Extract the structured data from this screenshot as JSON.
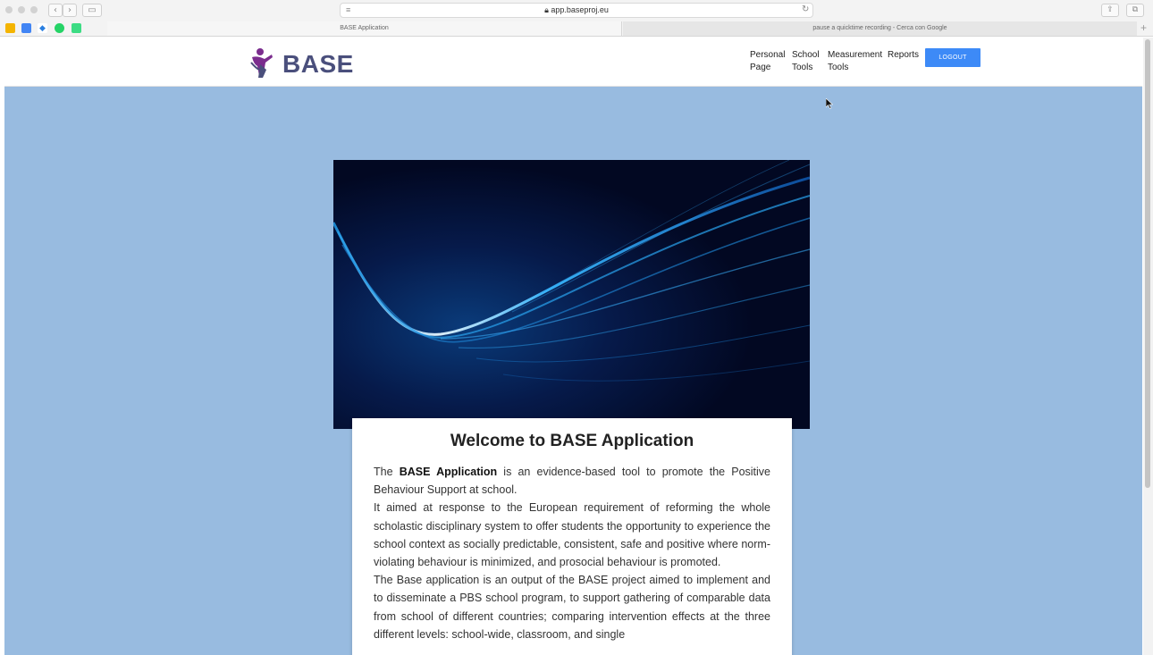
{
  "browser": {
    "url": "app.baseproj.eu",
    "tabs": [
      {
        "label": "BASE Application",
        "active": true
      },
      {
        "label": "pause a quicktime recording - Cerca con Google",
        "active": false
      }
    ],
    "favorite_icons": [
      "google-drive-icon",
      "google-translate-icon",
      "dropbox-icon",
      "whatsapp-icon",
      "android-icon"
    ]
  },
  "header": {
    "logo_text": "BASE",
    "nav": [
      {
        "line1": "Personal",
        "line2": "Page"
      },
      {
        "line1": "School",
        "line2": "Tools"
      },
      {
        "line1": "Measurement",
        "line2": "Tools"
      },
      {
        "line1": "Reports",
        "line2": ""
      }
    ],
    "logout_label": "LOGOUT"
  },
  "main": {
    "title": "Welcome to BASE Application",
    "intro_prefix": "The ",
    "intro_bold": "BASE Application",
    "intro_rest": " is an evidence-based tool to promote the Positive Behaviour Support at school.",
    "paragraph2": "It aimed at response to the European requirement of reforming the whole scholastic disciplinary system to offer students the opportunity to experience the school context as socially predictable, consistent, safe and positive where norm-violating behaviour is minimized, and prosocial behaviour is promoted.",
    "paragraph3": "The Base application is an output of the BASE project aimed to implement and to disseminate a PBS school program, to support gathering of comparable data from school of different countries; comparing intervention effects at the three different levels: school-wide, classroom, and single"
  },
  "colors": {
    "page_background": "#98bbe0",
    "logout_button": "#3d8af7",
    "logo_text": "#4a4f7c",
    "logo_mark": "#7b2d8e"
  }
}
